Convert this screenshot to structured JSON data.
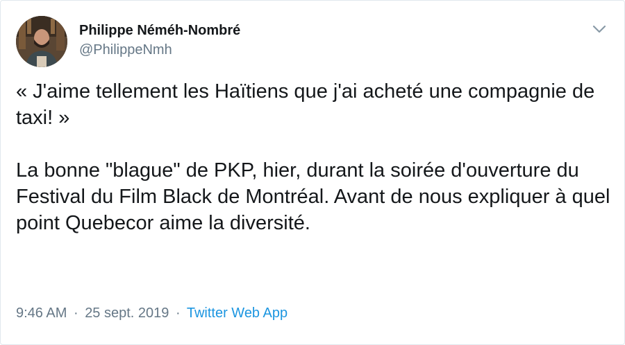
{
  "author": {
    "display_name": "Philippe Néméh-Nombré",
    "handle": "@PhilippeNmh"
  },
  "tweet": {
    "paragraph_1": "« J'aime tellement les Haïtiens que j'ai acheté une compagnie de taxi! »",
    "paragraph_2": "La bonne \"blague\" de PKP, hier, durant la soirée d'ouverture du Festival du Film Black de Montréal. Avant de nous expliquer à quel point Quebecor aime la diversité."
  },
  "meta": {
    "time": "9:46 AM",
    "separator": "·",
    "date": "25 sept. 2019",
    "source": "Twitter Web App"
  },
  "icons": {
    "menu": "chevron-down-icon",
    "avatar": "profile-photo"
  },
  "colors": {
    "text": "#14171a",
    "secondary": "#657786",
    "link": "#1b95e0",
    "border": "#e1e8ed"
  }
}
